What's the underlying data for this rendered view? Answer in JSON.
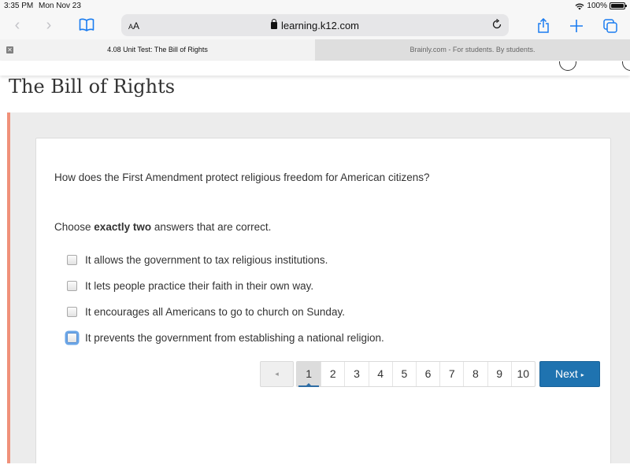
{
  "status_bar": {
    "time": "3:35 PM",
    "date": "Mon Nov 23",
    "battery": "100%"
  },
  "browser": {
    "text_size_label_small": "A",
    "text_size_label_large": "A",
    "url": "learning.k12.com",
    "icons": [
      "back-icon",
      "forward-icon",
      "bookmarks-icon",
      "lock-icon",
      "reload-icon",
      "share-icon",
      "new-tab-icon",
      "tabs-icon"
    ],
    "tabs": [
      {
        "title": "4.08 Unit Test: The Bill of Rights",
        "active": true
      },
      {
        "title": "Brainly.com - For students. By students.",
        "active": false
      }
    ]
  },
  "page": {
    "title": "The Bill of Rights",
    "accent_color": "#f0917a",
    "question": "How does the First Amendment protect religious freedom for American citizens?",
    "instructions": {
      "prefix": "Choose ",
      "emphasis": "exactly two",
      "suffix": " answers that are correct."
    },
    "options": [
      {
        "label": "It allows the government to tax religious institutions.",
        "checked": false
      },
      {
        "label": "It lets people practice their faith in their own way.",
        "checked": false
      },
      {
        "label": "It encourages all Americans to go to church on Sunday.",
        "checked": false
      },
      {
        "label": "It prevents the government from establishing a national religion.",
        "checked": false,
        "focused": true
      }
    ],
    "pagination": {
      "prev_symbol": "◂",
      "pages": [
        "1",
        "2",
        "3",
        "4",
        "5",
        "6",
        "7",
        "8",
        "9",
        "10"
      ],
      "current": "1",
      "next_label": "Next",
      "next_symbol": "▸",
      "next_color": "#1f73b0"
    }
  }
}
